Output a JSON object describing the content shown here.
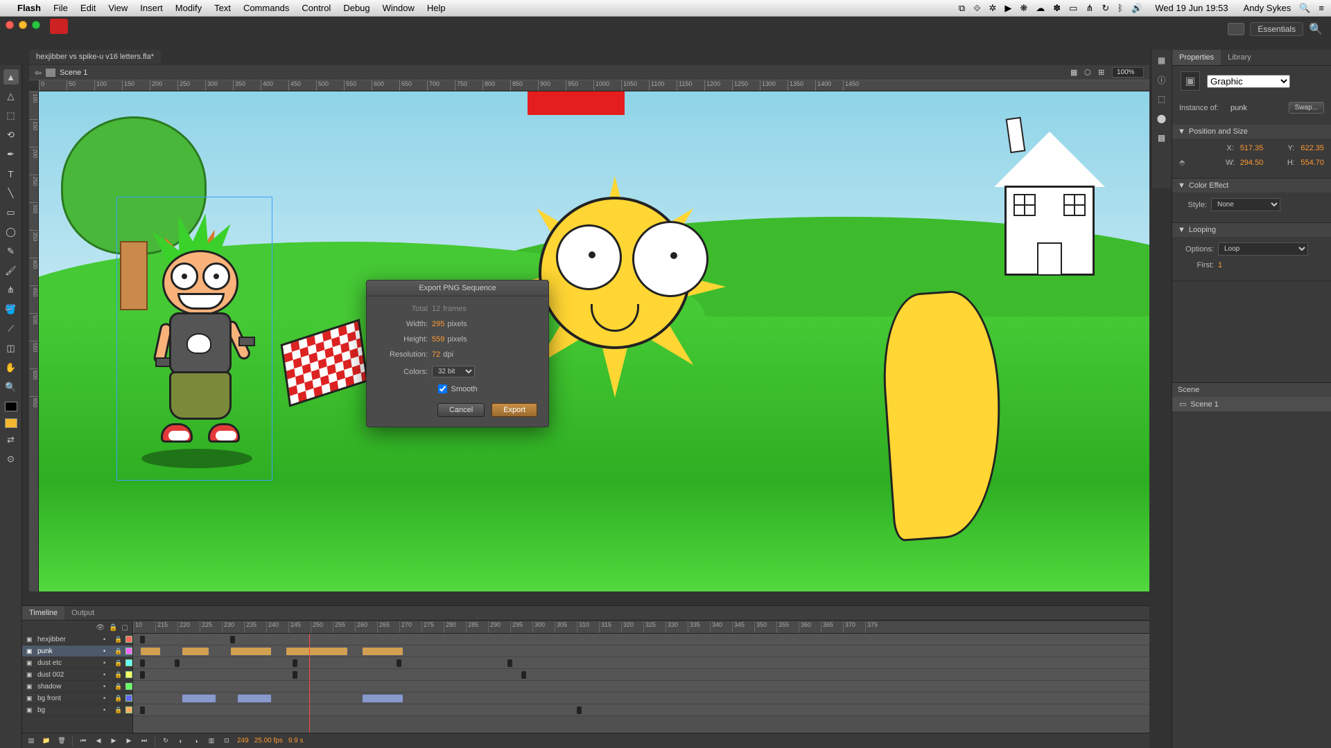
{
  "menubar": {
    "app": "Flash",
    "items": [
      "File",
      "Edit",
      "View",
      "Insert",
      "Modify",
      "Text",
      "Commands",
      "Control",
      "Debug",
      "Window",
      "Help"
    ],
    "clock": "Wed 19 Jun  19:53",
    "user": "Andy Sykes"
  },
  "workspace": {
    "label": "Essentials"
  },
  "document": {
    "tab": "hexjibber vs spike-u v16 letters.fla*"
  },
  "scene_bar": {
    "scene": "Scene 1",
    "zoom": "100%"
  },
  "ruler_h": [
    "0",
    "50",
    "100",
    "150",
    "200",
    "250",
    "300",
    "350",
    "400",
    "450",
    "500",
    "550",
    "600",
    "650",
    "700",
    "750",
    "800",
    "850",
    "900",
    "950",
    "1000",
    "1050",
    "1100",
    "1150",
    "1200",
    "1250",
    "1300",
    "1350",
    "1400",
    "1450"
  ],
  "ruler_v": [
    "100",
    "150",
    "200",
    "250",
    "300",
    "350",
    "400",
    "450",
    "500",
    "550",
    "600",
    "650"
  ],
  "dialog": {
    "title": "Export PNG Sequence",
    "total_label": "Total",
    "total_value": "12",
    "total_unit": "frames",
    "width_label": "Width:",
    "width_value": "295",
    "width_unit": "pixels",
    "height_label": "Height:",
    "height_value": "559",
    "height_unit": "pixels",
    "res_label": "Resolution:",
    "res_value": "72",
    "res_unit": "dpi",
    "colors_label": "Colors:",
    "colors_value": "32 bit",
    "smooth_label": "Smooth",
    "cancel": "Cancel",
    "export": "Export"
  },
  "panels": {
    "tabs": [
      "Properties",
      "Library"
    ],
    "type": "Graphic",
    "instance_of_label": "Instance of:",
    "instance_of_value": "punk",
    "swap_btn": "Swap...",
    "sections": {
      "position": {
        "title": "Position and Size",
        "x_label": "X:",
        "x_value": "517.35",
        "y_label": "Y:",
        "y_value": "622.35",
        "w_label": "W:",
        "w_value": "294.50",
        "h_label": "H:",
        "h_value": "554.70"
      },
      "color": {
        "title": "Color Effect",
        "style_label": "Style:",
        "style_value": "None"
      },
      "looping": {
        "title": "Looping",
        "options_label": "Options:",
        "options_value": "Loop",
        "first_label": "First:",
        "first_value": "1"
      }
    },
    "scene": {
      "title": "Scene",
      "item": "Scene 1"
    }
  },
  "timeline": {
    "tabs": [
      "Timeline",
      "Output"
    ],
    "layers": [
      "hexjibber",
      "punk",
      "dust etc",
      "dust 002",
      "shadow",
      "bg front",
      "bg"
    ],
    "frames": [
      "10",
      "215",
      "220",
      "225",
      "230",
      "235",
      "240",
      "245",
      "250",
      "255",
      "260",
      "265",
      "270",
      "275",
      "280",
      "285",
      "290",
      "295",
      "300",
      "305",
      "310",
      "315",
      "320",
      "325",
      "330",
      "335",
      "340",
      "345",
      "350",
      "355",
      "360",
      "365",
      "370",
      "375"
    ],
    "footer": {
      "frame": "249",
      "fps": "25.00 fps",
      "time": "9.9 s"
    }
  }
}
